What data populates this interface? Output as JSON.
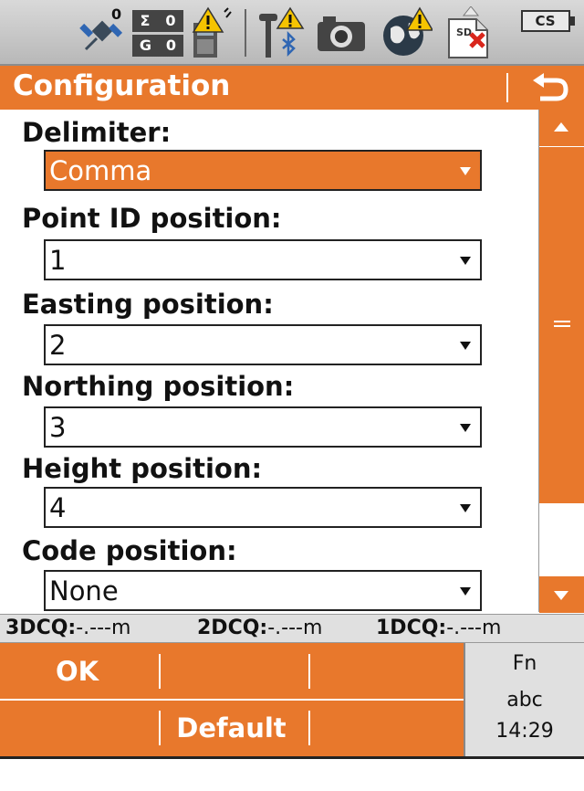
{
  "status_icons": [
    "satellite-icon",
    "sigma-counter-icon",
    "device-warning-icon",
    "pole-bluetooth-icon",
    "camera-icon",
    "globe-warning-icon",
    "sd-card-error-icon",
    "cs-battery-icon"
  ],
  "status_counters": {
    "sigma_label": "Σ",
    "sigma_value": "0",
    "g_label": "G",
    "g_value": "0",
    "sat_value": "0",
    "cs_label": "CS",
    "sd_label": "SD"
  },
  "header": {
    "title": "Configuration"
  },
  "fields": [
    {
      "label": "Delimiter:",
      "value": "Comma"
    },
    {
      "label": "Point ID position:",
      "value": "1"
    },
    {
      "label": "Easting position:",
      "value": "2"
    },
    {
      "label": "Northing position:",
      "value": "3"
    },
    {
      "label": "Height position:",
      "value": "4"
    },
    {
      "label": "Code position:",
      "value": "None"
    }
  ],
  "quality": [
    {
      "label": "3DCQ:",
      "value": "-.---m"
    },
    {
      "label": "2DCQ:",
      "value": "-.---m"
    },
    {
      "label": "1DCQ:",
      "value": "-.---m"
    }
  ],
  "softkeys": {
    "ok": "OK",
    "default": "Default",
    "fn": "Fn",
    "input_mode": "abc",
    "time": "14:29"
  },
  "colors": {
    "accent": "#e8782c",
    "status_bg": "#c8c8c8",
    "warning": "#f5c400",
    "error": "#d9261c"
  }
}
